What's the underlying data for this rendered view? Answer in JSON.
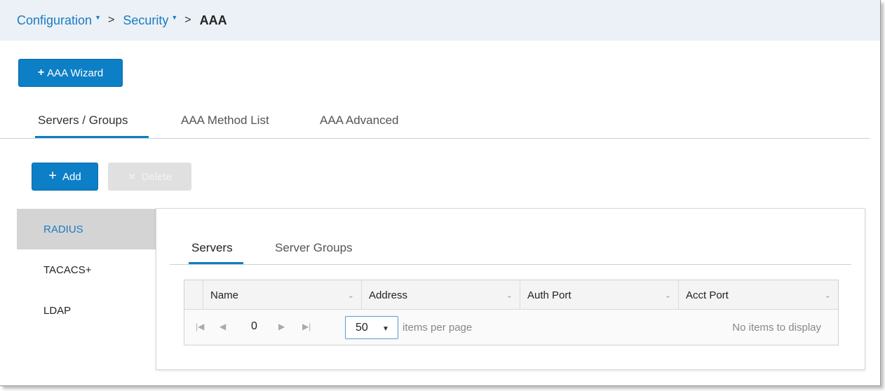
{
  "breadcrumb": {
    "items": [
      "Configuration",
      "Security"
    ],
    "current": "AAA"
  },
  "wizard_button": {
    "label": "AAA Wizard"
  },
  "main_tabs": [
    {
      "label": "Servers / Groups",
      "active": true
    },
    {
      "label": "AAA Method List",
      "active": false
    },
    {
      "label": "AAA Advanced",
      "active": false
    }
  ],
  "actions": {
    "add_label": "Add",
    "delete_label": "Delete"
  },
  "sidebar": {
    "items": [
      {
        "label": "RADIUS",
        "active": true
      },
      {
        "label": "TACACS+",
        "active": false
      },
      {
        "label": "LDAP",
        "active": false
      }
    ]
  },
  "sub_tabs": [
    {
      "label": "Servers",
      "active": true
    },
    {
      "label": "Server Groups",
      "active": false
    }
  ],
  "grid": {
    "columns": [
      "Name",
      "Address",
      "Auth Port",
      "Acct Port"
    ],
    "rows": []
  },
  "pager": {
    "page": "0",
    "page_size": "50",
    "per_page_label": "items per page",
    "empty_message": "No items to display"
  },
  "colors": {
    "accent": "#0d7fc7",
    "link": "#1a7bc4",
    "header_bg": "#ebf1f6"
  }
}
